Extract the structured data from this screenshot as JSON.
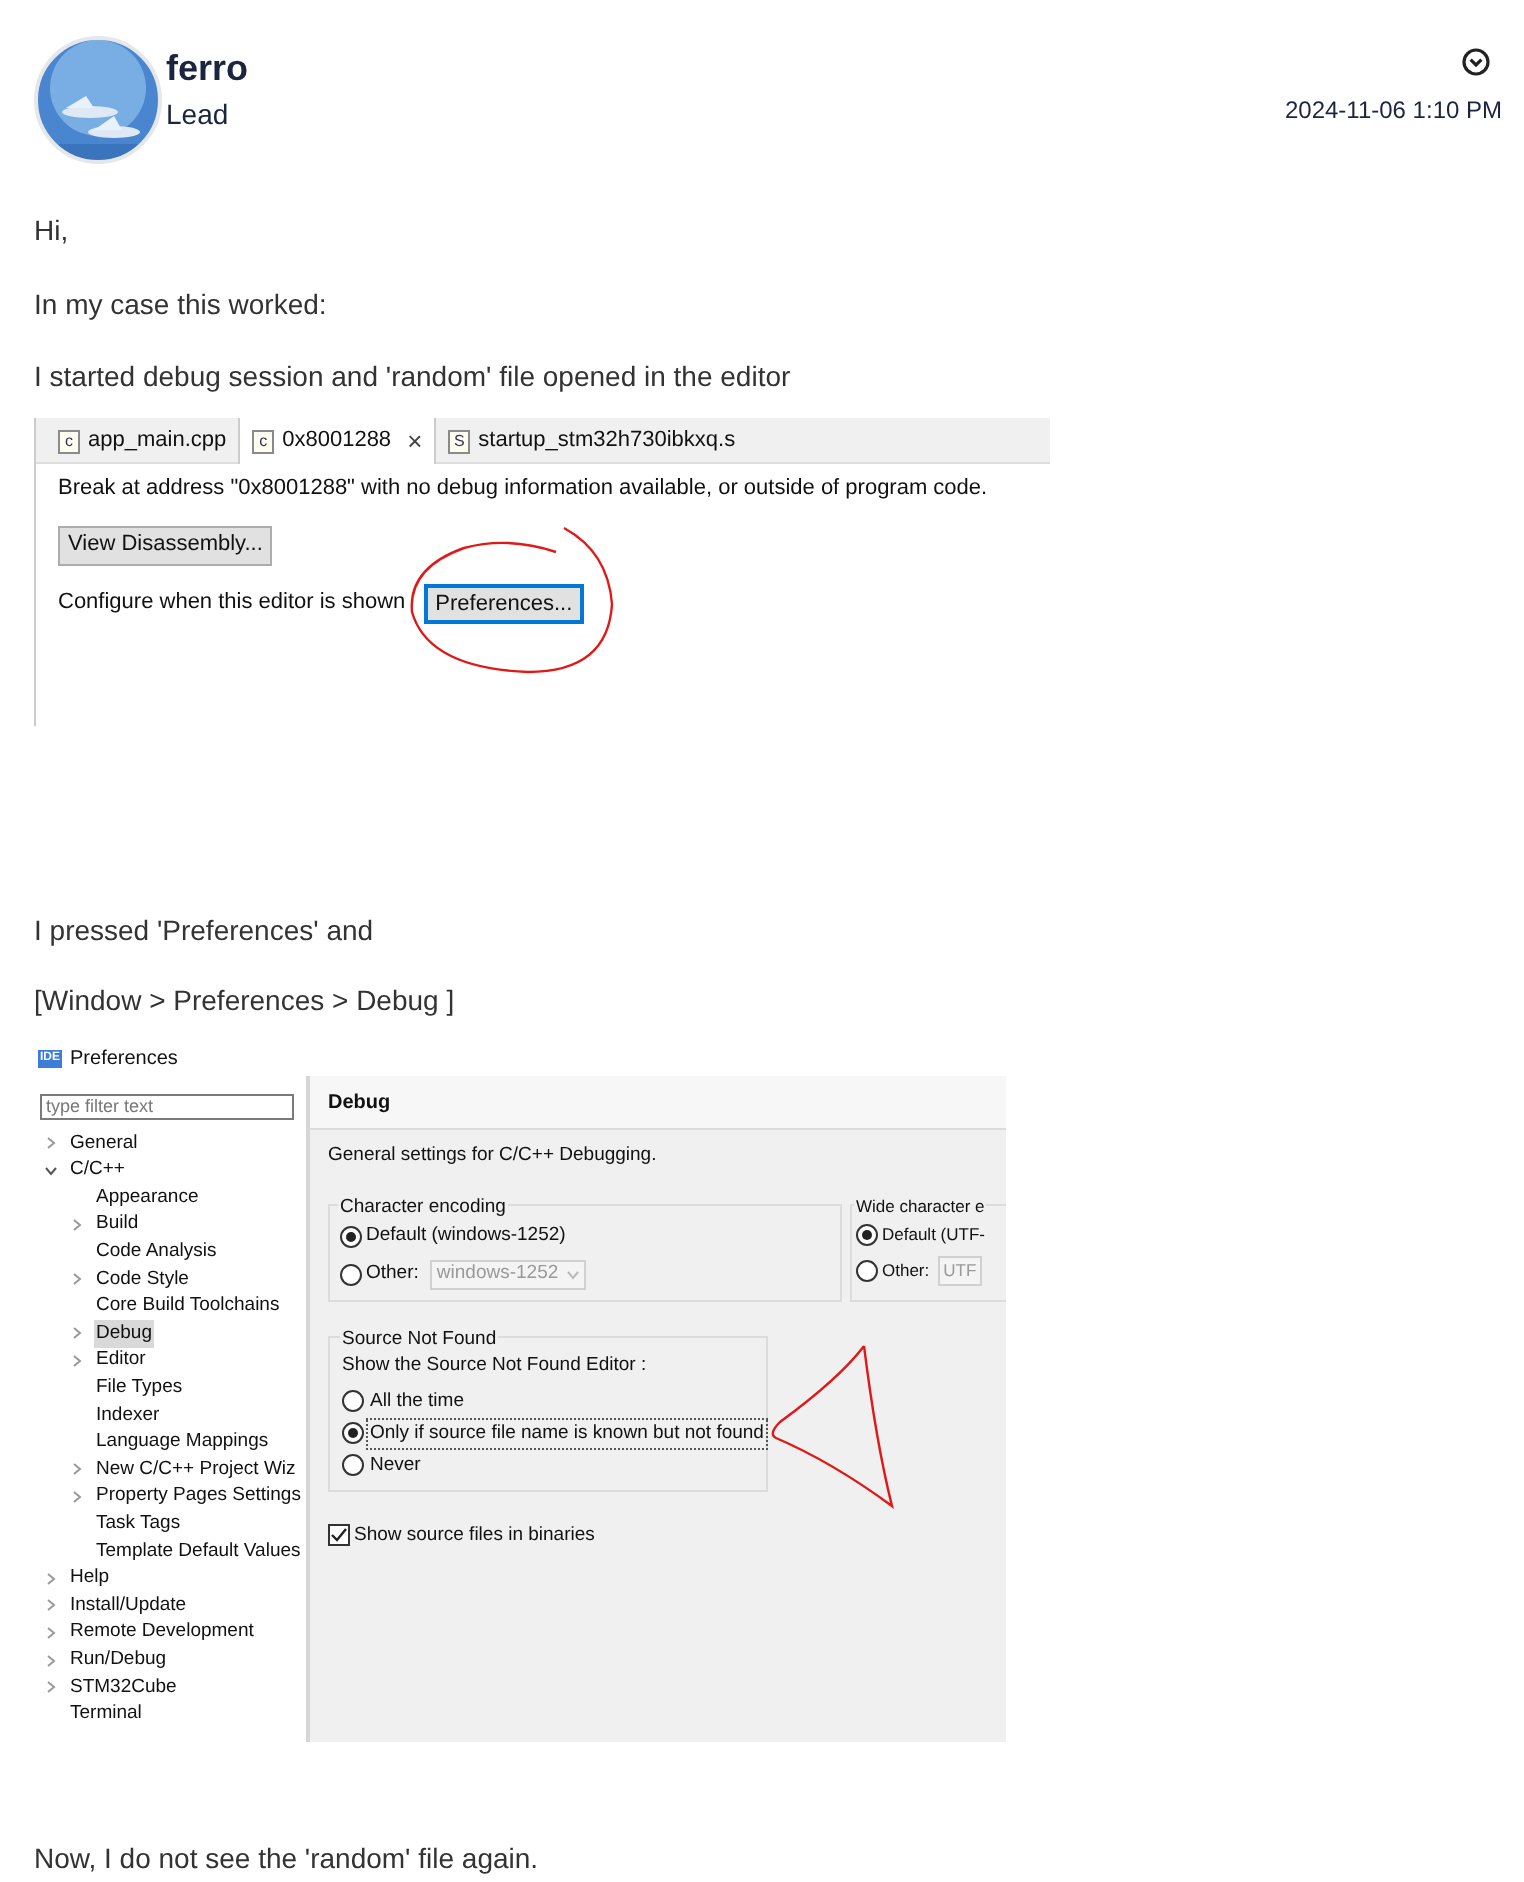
{
  "post": {
    "author": "ferro",
    "rank": "Lead",
    "date": "2024-11-06 1:10 PM"
  },
  "body": [
    {
      "kind": "text",
      "text": "Hi,"
    },
    {
      "kind": "text",
      "text": "In my case this worked:"
    },
    {
      "kind": "text",
      "text": "I started debug session and 'random' file opened in the editor"
    },
    {
      "kind": "editor_shot",
      "tabs": [
        {
          "icon": "c",
          "label": "app_main.cpp",
          "selected": false
        },
        {
          "icon": "c",
          "label": "0x8001288",
          "selected": true,
          "close": "×"
        },
        {
          "icon": "S",
          "label": "startup_stm32h730ibkxq.s",
          "selected": false
        }
      ],
      "message": "Break at address \"0x8001288\" with no debug information available, or outside of program code.",
      "disassembly_button": "View Disassembly...",
      "configure_label": "Configure when this editor is shown",
      "preferences_button": "Preferences..."
    },
    {
      "kind": "text",
      "text": "I pressed 'Preferences' and"
    },
    {
      "kind": "text",
      "text": "[Window > Preferences > Debug ]"
    },
    {
      "kind": "prefs_shot",
      "title_icon": "IDE",
      "title": "Preferences",
      "filter_placeholder": "type filter text",
      "tree": [
        {
          "label": "General",
          "kind": "folder",
          "expanded": false,
          "selected": false
        },
        {
          "label": "C/C++",
          "kind": "folder",
          "expanded": true,
          "selected": false,
          "children": [
            {
              "label": "Appearance",
              "kind": "leaf",
              "selected": false
            },
            {
              "label": "Build",
              "kind": "folder",
              "expanded": false,
              "selected": false
            },
            {
              "label": "Code Analysis",
              "kind": "leaf",
              "selected": false
            },
            {
              "label": "Code Style",
              "kind": "folder",
              "expanded": false,
              "selected": false
            },
            {
              "label": "Core Build Toolchains",
              "kind": "leaf",
              "selected": false
            },
            {
              "label": "Debug",
              "kind": "folder",
              "expanded": false,
              "selected": true
            },
            {
              "label": "Editor",
              "kind": "folder",
              "expanded": false,
              "selected": false
            },
            {
              "label": "File Types",
              "kind": "leaf",
              "selected": false
            },
            {
              "label": "Indexer",
              "kind": "leaf",
              "selected": false
            },
            {
              "label": "Language Mappings",
              "kind": "leaf",
              "selected": false
            },
            {
              "label": "New C/C++ Project Wiz",
              "kind": "folder",
              "expanded": false,
              "selected": false
            },
            {
              "label": "Property Pages Settings",
              "kind": "folder",
              "expanded": false,
              "selected": false
            },
            {
              "label": "Task Tags",
              "kind": "leaf",
              "selected": false
            },
            {
              "label": "Template Default Values",
              "kind": "leaf",
              "selected": false
            }
          ]
        },
        {
          "label": "Help",
          "kind": "folder",
          "expanded": false,
          "selected": false
        },
        {
          "label": "Install/Update",
          "kind": "folder",
          "expanded": false,
          "selected": false
        },
        {
          "label": "Remote Development",
          "kind": "folder",
          "expanded": false,
          "selected": false
        },
        {
          "label": "Run/Debug",
          "kind": "folder",
          "expanded": false,
          "selected": false
        },
        {
          "label": "STM32Cube",
          "kind": "folder",
          "expanded": false,
          "selected": false
        },
        {
          "label": "Terminal",
          "kind": "leaf",
          "selected": false
        }
      ],
      "page_title": "Debug",
      "description": "General settings for C/C++ Debugging.",
      "encoding_groups": [
        {
          "title": "Character encoding",
          "options": [
            {
              "label": "Default (windows-1252)",
              "selected": true
            },
            {
              "label": "Other:",
              "selected": false
            }
          ],
          "other_value": "windows-1252"
        },
        {
          "title": "Wide character e",
          "options": [
            {
              "label": "Default (UTF-",
              "selected": true
            },
            {
              "label": "Other:",
              "selected": false
            }
          ],
          "other_value": "UTF"
        }
      ],
      "source_group": {
        "title": "Source Not Found",
        "prompt": "Show the Source Not Found Editor :",
        "options": [
          {
            "label": "All the time",
            "selected": false
          },
          {
            "label": "Only if source file name is known but not found",
            "selected": true
          },
          {
            "label": "Never",
            "selected": false
          }
        ]
      },
      "binaries_checkbox": {
        "label": "Show source files in binaries",
        "checked": true
      }
    },
    {
      "kind": "text",
      "text": "Now, I do not see the 'random' file again."
    }
  ]
}
